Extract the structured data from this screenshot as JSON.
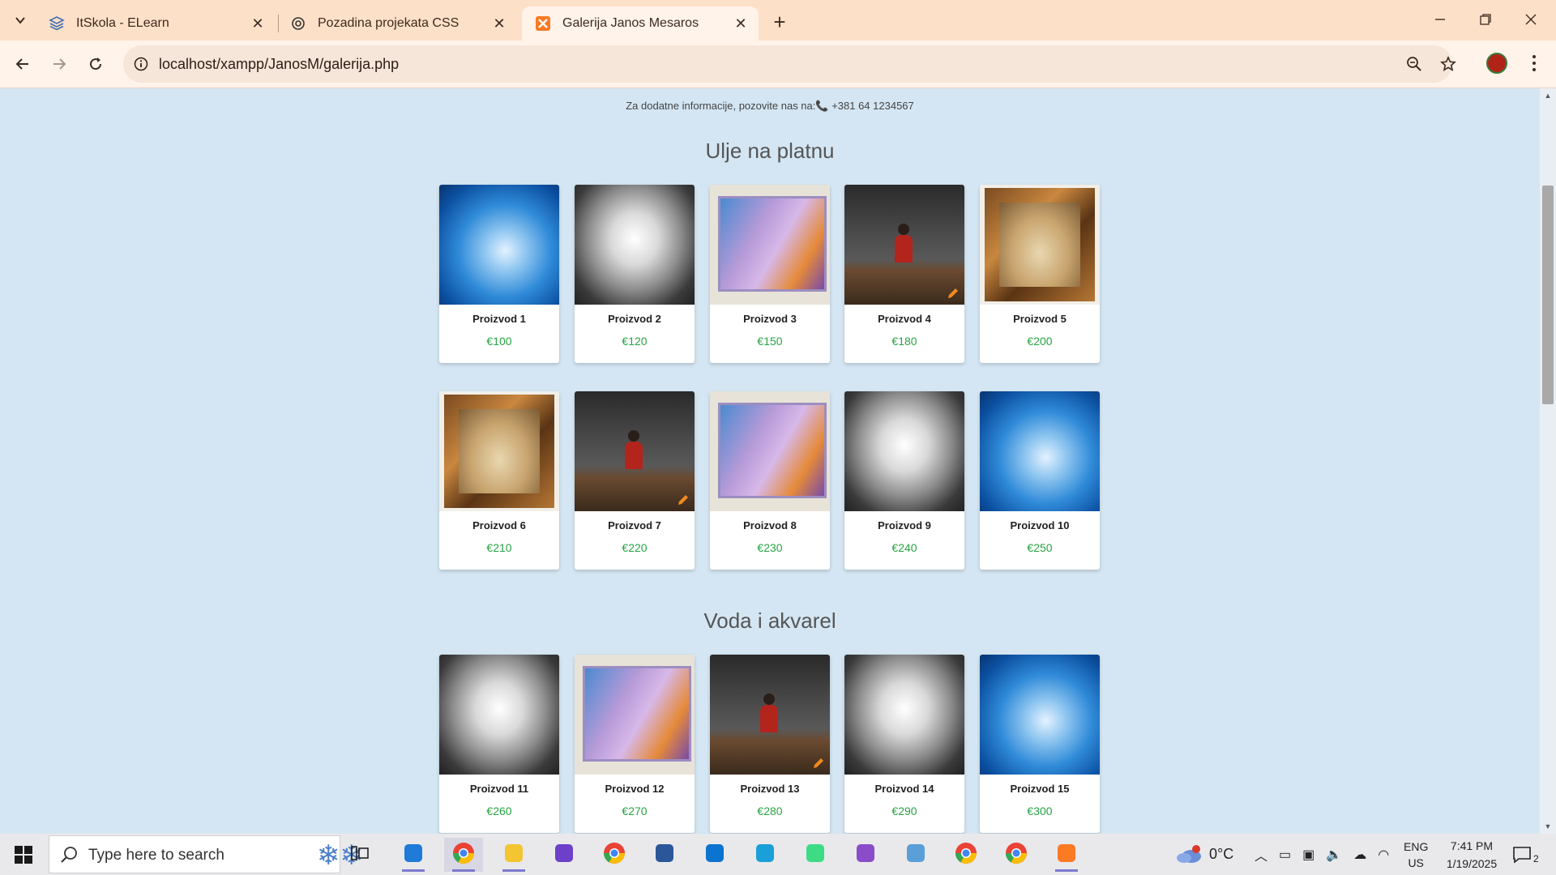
{
  "browser": {
    "tabs": [
      {
        "title": "ItSkola - ELearn",
        "icon": "layers-icon"
      },
      {
        "title": "Pozadina projekata CSS",
        "icon": "openai-icon"
      },
      {
        "title": "Galerija Janos Mesaros",
        "icon": "xampp-icon",
        "active": true
      }
    ],
    "url": "localhost/xampp/JanosM/galerija.php"
  },
  "page": {
    "contact_text": "Za dodatne informacije, pozovite nas na:",
    "contact_phone": "+381 64 1234567",
    "sections": [
      {
        "title": "Ulje na platnu",
        "products": [
          {
            "name": "Proizvod 1",
            "price": "€100",
            "art": "blue"
          },
          {
            "name": "Proizvod 2",
            "price": "€120",
            "art": "white"
          },
          {
            "name": "Proizvod 3",
            "price": "€150",
            "art": "purple"
          },
          {
            "name": "Proizvod 4",
            "price": "€180",
            "art": "red"
          },
          {
            "name": "Proizvod 5",
            "price": "€200",
            "art": "frame"
          },
          {
            "name": "Proizvod 6",
            "price": "€210",
            "art": "frame"
          },
          {
            "name": "Proizvod 7",
            "price": "€220",
            "art": "red"
          },
          {
            "name": "Proizvod 8",
            "price": "€230",
            "art": "purple"
          },
          {
            "name": "Proizvod 9",
            "price": "€240",
            "art": "white"
          },
          {
            "name": "Proizvod 10",
            "price": "€250",
            "art": "blue"
          }
        ]
      },
      {
        "title": "Voda i akvarel",
        "products": [
          {
            "name": "Proizvod 11",
            "price": "€260",
            "art": "white"
          },
          {
            "name": "Proizvod 12",
            "price": "€270",
            "art": "purple"
          },
          {
            "name": "Proizvod 13",
            "price": "€280",
            "art": "red"
          },
          {
            "name": "Proizvod 14",
            "price": "€290",
            "art": "white"
          },
          {
            "name": "Proizvod 15",
            "price": "€300",
            "art": "blue"
          }
        ]
      }
    ]
  },
  "taskbar": {
    "search_placeholder": "Type here to search",
    "weather": "0°C",
    "language": "ENG",
    "region": "US",
    "time": "7:41 PM",
    "date": "1/19/2025",
    "notification_count": "2",
    "apps": [
      "task-view-icon",
      "vscode-icon",
      "chrome-profile-icon",
      "file-explorer-icon",
      "github-icon",
      "chrome-icon",
      "word-icon",
      "app-icon",
      "edge-icon",
      "android-studio-icon",
      "visual-studio-icon",
      "cube-icon",
      "chrome-s-icon",
      "chrome-icon-2",
      "xampp-icon"
    ]
  },
  "colors": {
    "tab_strip": "#fde0c8",
    "page_bg": "#d4e6f3",
    "price": "#27a344"
  }
}
